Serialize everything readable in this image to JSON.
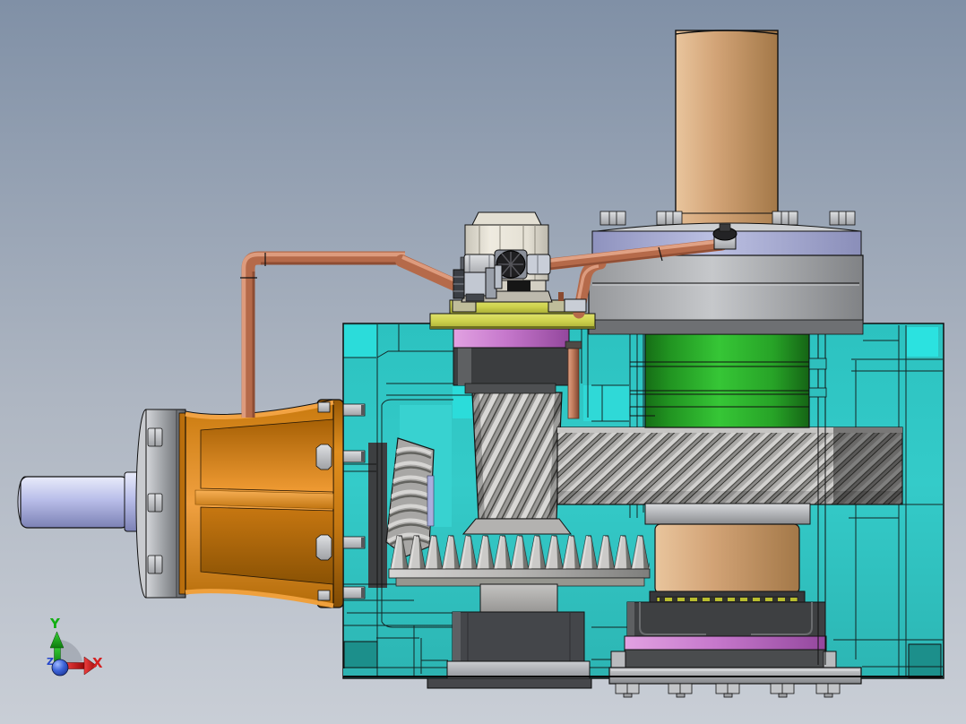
{
  "scene": {
    "title": "Spiral bevel-helical gear reducer - CAD section view",
    "background_top": "#8090A6",
    "background_bottom": "#C9CED6"
  },
  "triad": {
    "x_label": "X",
    "y_label": "Y",
    "z_label": "Z",
    "x_color": "#D42020",
    "y_color": "#12AE12",
    "z_color": "#2547CC"
  },
  "parts": {
    "housing": {
      "name": "Transparent gear housing",
      "color": "#34CBC9"
    },
    "input_shaft": {
      "name": "Input shaft",
      "color": "#B9BEE9"
    },
    "input_cone": {
      "name": "Input bell housing",
      "color": "#E08E1E"
    },
    "bevel_pinion": {
      "name": "Spiral bevel pinion",
      "color": "#A8A7A5"
    },
    "crown_gear": {
      "name": "Spiral bevel crown gear",
      "color": "#C9C8C6"
    },
    "vertical_pinion": {
      "name": "Helical pinion shaft",
      "color": "#B9B8B6"
    },
    "output_gear": {
      "name": "Output helical gear",
      "color": "#B4B3B1"
    },
    "green_hub": {
      "name": "Output gear hub",
      "color": "#36C636"
    },
    "output_shaft": {
      "name": "Output shaft",
      "color": "#D2A376"
    },
    "bearing_drum": {
      "name": "Upper output bearing housing",
      "color": "#C6C8CB"
    },
    "cover_ring": {
      "name": "Bearing cover ring",
      "color": "#BCC0E2"
    },
    "seal_ring": {
      "name": "Seal ring",
      "color": "#C678CC"
    },
    "bearing_cover": {
      "name": "Vertical shaft bearing cover",
      "color": "#CDD14C"
    },
    "breather": {
      "name": "Breather and oil valve",
      "color": "#E3DFD3"
    },
    "piping": {
      "name": "Copper oil piping",
      "color": "#B56A4A"
    }
  }
}
